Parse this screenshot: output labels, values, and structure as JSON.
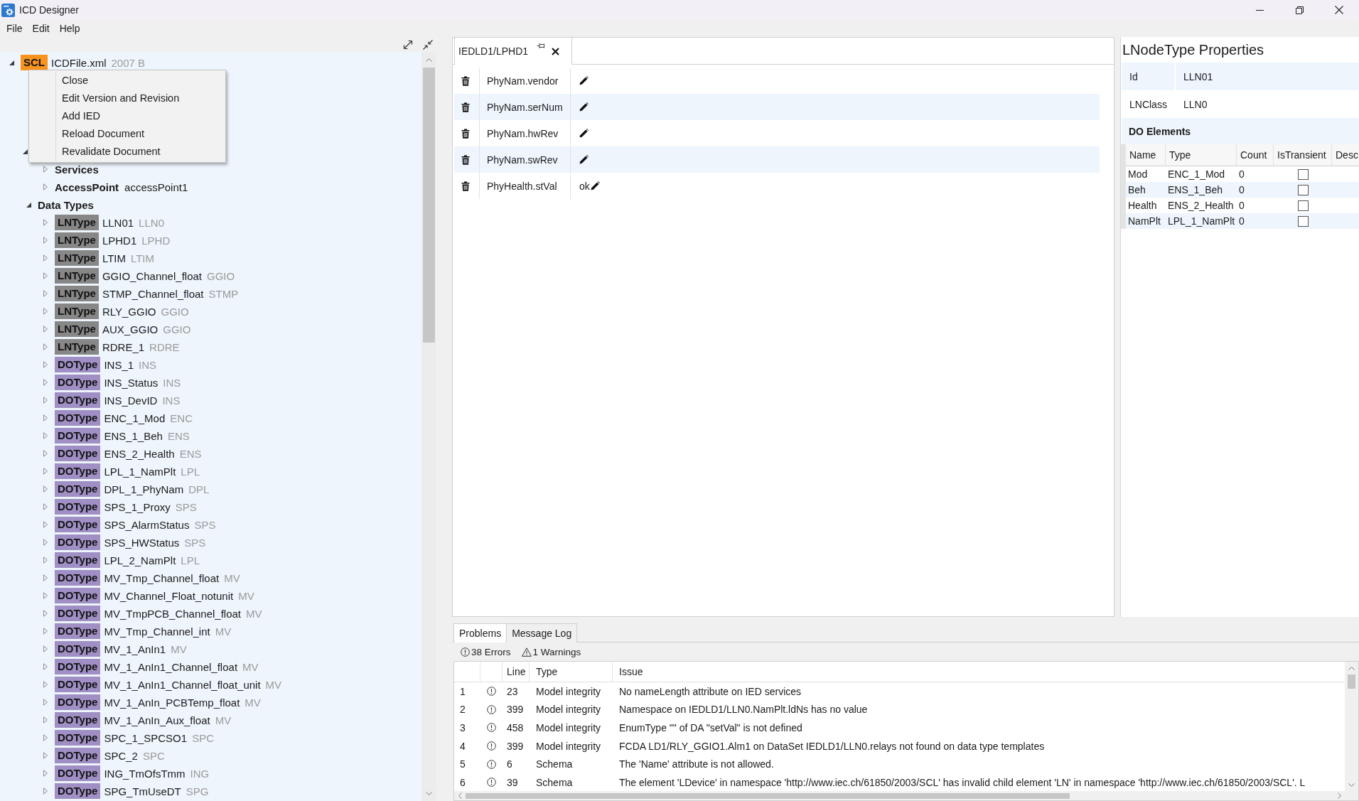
{
  "window": {
    "title": "ICD Designer"
  },
  "menu": [
    "File",
    "Edit",
    "Help"
  ],
  "tree": [
    {
      "kind": "file",
      "badge": "SCL",
      "color": "#f7931e",
      "name": "ICDFile.xml",
      "detail": "2007 B",
      "expanded": true,
      "children": [
        {
          "kind": "covered",
          "expanded": true,
          "children": [
            {
              "kind": "element",
              "name": "Services",
              "expanded": false
            },
            {
              "kind": "element",
              "name": "AccessPoint",
              "value": "accessPoint1",
              "expanded": false
            }
          ]
        },
        {
          "kind": "group",
          "name": "Data Types",
          "expanded": true,
          "children": [
            {
              "kind": "type",
              "badge": "LNType",
              "color": "#878787",
              "name": "LLN01",
              "detail": "LLN0",
              "expanded": false
            },
            {
              "kind": "type",
              "badge": "LNType",
              "color": "#878787",
              "name": "LPHD1",
              "detail": "LPHD",
              "expanded": false
            },
            {
              "kind": "type",
              "badge": "LNType",
              "color": "#878787",
              "name": "LTIM",
              "detail": "LTIM",
              "expanded": false
            },
            {
              "kind": "type",
              "badge": "LNType",
              "color": "#878787",
              "name": "GGIO_Channel_float",
              "detail": "GGIO",
              "expanded": false
            },
            {
              "kind": "type",
              "badge": "LNType",
              "color": "#878787",
              "name": "STMP_Channel_float",
              "detail": "STMP",
              "expanded": false
            },
            {
              "kind": "type",
              "badge": "LNType",
              "color": "#878787",
              "name": "RLY_GGIO",
              "detail": "GGIO",
              "expanded": false
            },
            {
              "kind": "type",
              "badge": "LNType",
              "color": "#878787",
              "name": "AUX_GGIO",
              "detail": "GGIO",
              "expanded": false
            },
            {
              "kind": "type",
              "badge": "LNType",
              "color": "#878787",
              "name": "RDRE_1",
              "detail": "RDRE",
              "expanded": false
            },
            {
              "kind": "type",
              "badge": "DOType",
              "color": "#9f8fc4",
              "name": "INS_1",
              "detail": "INS",
              "expanded": false
            },
            {
              "kind": "type",
              "badge": "DOType",
              "color": "#9f8fc4",
              "name": "INS_Status",
              "detail": "INS",
              "expanded": false
            },
            {
              "kind": "type",
              "badge": "DOType",
              "color": "#9f8fc4",
              "name": "INS_DevID",
              "detail": "INS",
              "expanded": false
            },
            {
              "kind": "type",
              "badge": "DOType",
              "color": "#9f8fc4",
              "name": "ENC_1_Mod",
              "detail": "ENC",
              "expanded": false
            },
            {
              "kind": "type",
              "badge": "DOType",
              "color": "#9f8fc4",
              "name": "ENS_1_Beh",
              "detail": "ENS",
              "expanded": false
            },
            {
              "kind": "type",
              "badge": "DOType",
              "color": "#9f8fc4",
              "name": "ENS_2_Health",
              "detail": "ENS",
              "expanded": false
            },
            {
              "kind": "type",
              "badge": "DOType",
              "color": "#9f8fc4",
              "name": "LPL_1_NamPlt",
              "detail": "LPL",
              "expanded": false
            },
            {
              "kind": "type",
              "badge": "DOType",
              "color": "#9f8fc4",
              "name": "DPL_1_PhyNam",
              "detail": "DPL",
              "expanded": false
            },
            {
              "kind": "type",
              "badge": "DOType",
              "color": "#9f8fc4",
              "name": "SPS_1_Proxy",
              "detail": "SPS",
              "expanded": false
            },
            {
              "kind": "type",
              "badge": "DOType",
              "color": "#9f8fc4",
              "name": "SPS_AlarmStatus",
              "detail": "SPS",
              "expanded": false
            },
            {
              "kind": "type",
              "badge": "DOType",
              "color": "#9f8fc4",
              "name": "SPS_HWStatus",
              "detail": "SPS",
              "expanded": false
            },
            {
              "kind": "type",
              "badge": "DOType",
              "color": "#9f8fc4",
              "name": "LPL_2_NamPlt",
              "detail": "LPL",
              "expanded": false
            },
            {
              "kind": "type",
              "badge": "DOType",
              "color": "#9f8fc4",
              "name": "MV_Tmp_Channel_float",
              "detail": "MV",
              "expanded": false
            },
            {
              "kind": "type",
              "badge": "DOType",
              "color": "#9f8fc4",
              "name": "MV_Channel_Float_notunit",
              "detail": "MV",
              "expanded": false
            },
            {
              "kind": "type",
              "badge": "DOType",
              "color": "#9f8fc4",
              "name": "MV_TmpPCB_Channel_float",
              "detail": "MV",
              "expanded": false
            },
            {
              "kind": "type",
              "badge": "DOType",
              "color": "#9f8fc4",
              "name": "MV_Tmp_Channel_int",
              "detail": "MV",
              "expanded": false
            },
            {
              "kind": "type",
              "badge": "DOType",
              "color": "#9f8fc4",
              "name": "MV_1_AnIn1",
              "detail": "MV",
              "expanded": false
            },
            {
              "kind": "type",
              "badge": "DOType",
              "color": "#9f8fc4",
              "name": "MV_1_AnIn1_Channel_float",
              "detail": "MV",
              "expanded": false
            },
            {
              "kind": "type",
              "badge": "DOType",
              "color": "#9f8fc4",
              "name": "MV_1_AnIn1_Channel_float_unit",
              "detail": "MV",
              "expanded": false
            },
            {
              "kind": "type",
              "badge": "DOType",
              "color": "#9f8fc4",
              "name": "MV_1_AnIn_PCBTemp_float",
              "detail": "MV",
              "expanded": false
            },
            {
              "kind": "type",
              "badge": "DOType",
              "color": "#9f8fc4",
              "name": "MV_1_AnIn_Aux_float",
              "detail": "MV",
              "expanded": false
            },
            {
              "kind": "type",
              "badge": "DOType",
              "color": "#9f8fc4",
              "name": "SPC_1_SPCSO1",
              "detail": "SPC",
              "expanded": false
            },
            {
              "kind": "type",
              "badge": "DOType",
              "color": "#9f8fc4",
              "name": "SPC_2",
              "detail": "SPC",
              "expanded": false
            },
            {
              "kind": "type",
              "badge": "DOType",
              "color": "#9f8fc4",
              "name": "ING_TmOfsTmm",
              "detail": "ING",
              "expanded": false
            },
            {
              "kind": "type",
              "badge": "DOType",
              "color": "#9f8fc4",
              "name": "SPG_TmUseDT",
              "detail": "SPG",
              "expanded": false
            }
          ]
        }
      ]
    }
  ],
  "context_menu": {
    "items": [
      "Close",
      "Edit Version and Revision",
      "Add IED",
      "Reload Document",
      "Revalidate Document"
    ]
  },
  "editor": {
    "tabs": [
      {
        "label": "IEDLD1/LPHD1",
        "selected": true
      }
    ],
    "rows": [
      {
        "name": "PhyNam.vendor"
      },
      {
        "name": "PhyNam.serNum"
      },
      {
        "name": "PhyNam.hwRev"
      },
      {
        "name": "PhyNam.swRev"
      },
      {
        "name": "PhyHealth.stVal",
        "value": "ok"
      }
    ]
  },
  "properties": {
    "title": "LNodeType Properties",
    "fields": [
      {
        "label": "Id",
        "value": "LLN01"
      },
      {
        "label": "LNClass",
        "value": "LLN0"
      }
    ],
    "section": "DO Elements",
    "columns": [
      "Name",
      "Type",
      "Count",
      "IsTransient",
      "Desc"
    ],
    "rows": [
      {
        "name": "Mod",
        "type": "ENC_1_Mod",
        "count": "0",
        "transient": false
      },
      {
        "name": "Beh",
        "type": "ENS_1_Beh",
        "count": "0",
        "transient": false
      },
      {
        "name": "Health",
        "type": "ENS_2_Health",
        "count": "0",
        "transient": false
      },
      {
        "name": "NamPlt",
        "type": "LPL_1_NamPlt",
        "count": "0",
        "transient": false
      }
    ]
  },
  "problems": {
    "tabs": [
      {
        "label": "Problems",
        "selected": true
      },
      {
        "label": "Message Log",
        "selected": false
      }
    ],
    "errors": "38 Errors",
    "warnings": "1 Warnings",
    "columns": [
      "Line",
      "Type",
      "Issue"
    ],
    "rows": [
      {
        "number": "1",
        "line": "23",
        "type": "Model integrity",
        "issue": "No nameLength attribute on IED services"
      },
      {
        "number": "2",
        "line": "399",
        "type": "Model integrity",
        "issue": "Namespace on IEDLD1/LLN0.NamPlt.ldNs has no value"
      },
      {
        "number": "3",
        "line": "458",
        "type": "Model integrity",
        "issue": "EnumType \"\" of DA \"setVal\" is not defined"
      },
      {
        "number": "4",
        "line": "399",
        "type": "Model integrity",
        "issue": "FCDA LD1/RLY_GGIO1.Alm1 on DataSet IEDLD1/LLN0.relays not found on data type templates"
      },
      {
        "number": "5",
        "line": "6",
        "type": "Schema",
        "issue": "The 'Name' attribute is not allowed."
      },
      {
        "number": "6",
        "line": "39",
        "type": "Schema",
        "issue": "The element 'LDevice' in namespace 'http://www.iec.ch/61850/2003/SCL' has invalid child element 'LN' in namespace 'http://www.iec.ch/61850/2003/SCL'. L"
      }
    ]
  }
}
